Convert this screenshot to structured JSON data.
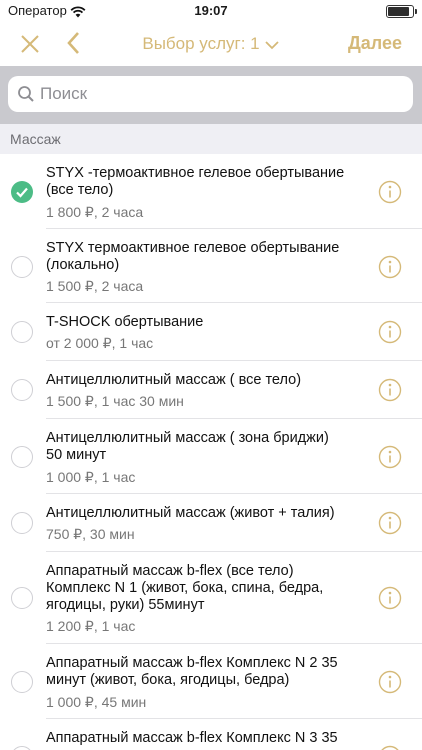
{
  "status_bar": {
    "carrier": "Оператор",
    "time": "19:07"
  },
  "nav": {
    "title": "Выбор услуг: 1",
    "next_label": "Далее"
  },
  "search": {
    "placeholder": "Поиск"
  },
  "section": {
    "title": "Массаж"
  },
  "colors": {
    "accent": "#d5b978",
    "check": "#4cbc86",
    "search_bg": "#c9c9ce",
    "section_bg": "#efeff4"
  },
  "services": [
    {
      "name": "STYX -термоактивное гелевое обертывание (все тело)",
      "price": "1 800 ₽, 2 часа",
      "selected": true
    },
    {
      "name": "STYX термоактивное гелевое обертывание (локально)",
      "price": "1 500 ₽, 2 часа",
      "selected": false
    },
    {
      "name": "T-SHOCK обертывание",
      "price": "от 2 000 ₽, 1 час",
      "selected": false
    },
    {
      "name": "Антицеллюлитный массаж ( все тело)",
      "price": "1 500 ₽, 1 час 30 мин",
      "selected": false
    },
    {
      "name": "Антицеллюлитный массаж ( зона бриджи) 50 минут",
      "price": "1 000 ₽, 1 час",
      "selected": false
    },
    {
      "name": "Антицеллюлитный массаж (живот + талия)",
      "price": "750 ₽,  30 мин",
      "selected": false
    },
    {
      "name": "Аппаратный массаж b-flex (все тело) Комплекс N 1 (живот, бока, спина, бедра, ягодицы, руки) 55минут",
      "price": "1 200 ₽, 1 час",
      "selected": false
    },
    {
      "name": "Аппаратный массаж b-flex Комплекс N 2 35 минут (живот, бока, ягодицы, бедра)",
      "price": "1 000 ₽,  45 мин",
      "selected": false
    },
    {
      "name": "Аппаратный массаж b-flex Комплекс N 3 35",
      "price": "",
      "selected": false
    }
  ]
}
